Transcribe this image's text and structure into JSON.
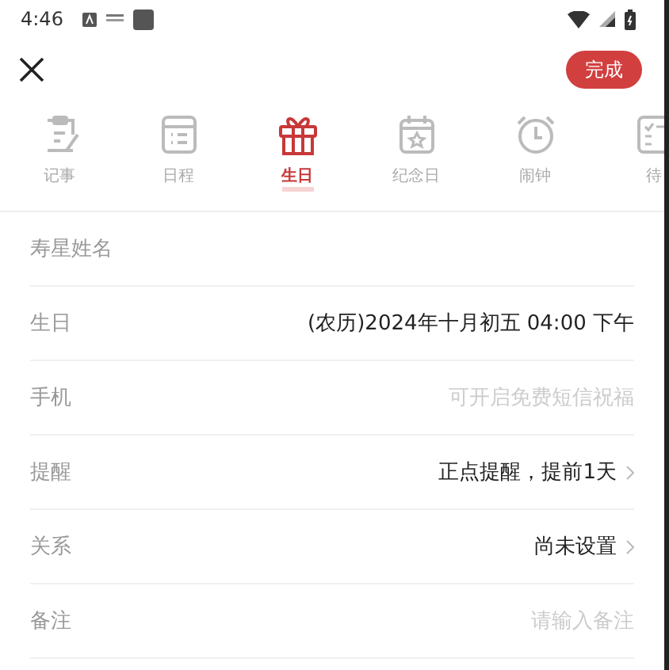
{
  "status_bar": {
    "time": "4:46"
  },
  "toolbar": {
    "done_button": "完成"
  },
  "tabs": [
    {
      "label": "记事",
      "selected": false
    },
    {
      "label": "日程",
      "selected": false
    },
    {
      "label": "生日",
      "selected": true
    },
    {
      "label": "纪念日",
      "selected": false
    },
    {
      "label": "闹钟",
      "selected": false
    },
    {
      "label": "待",
      "selected": false
    }
  ],
  "form": [
    {
      "kind": "input",
      "placeholder": "寿星姓名"
    },
    {
      "kind": "value",
      "label": "生日",
      "value": "(农历)2024年十月初五 04:00 下午"
    },
    {
      "kind": "input_labeled",
      "label": "手机",
      "placeholder": "可开启免费短信祝福"
    },
    {
      "kind": "link",
      "label": "提醒",
      "value": "正点提醒，提前1天"
    },
    {
      "kind": "link",
      "label": "关系",
      "value": "尚未设置"
    },
    {
      "kind": "input_labeled",
      "label": "备注",
      "placeholder": "请输入备注"
    }
  ]
}
